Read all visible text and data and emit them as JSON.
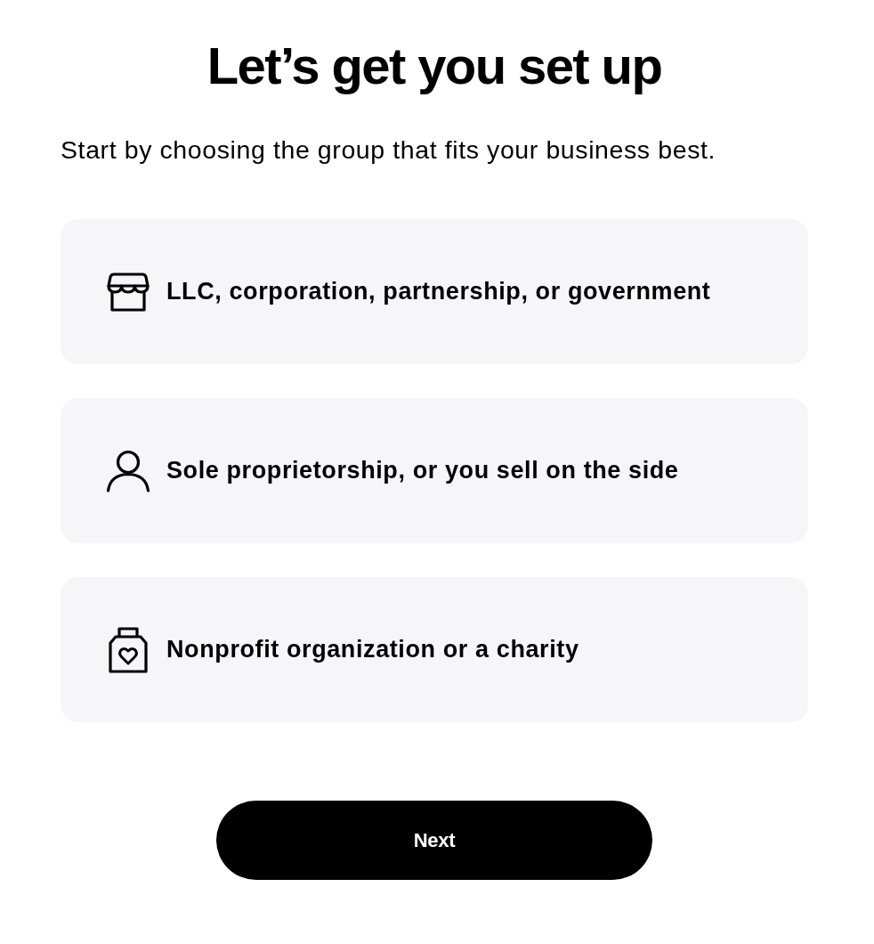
{
  "title": "Let’s get you set up",
  "subtitle": "Start by choosing the group that fits your business best.",
  "options": [
    {
      "label": "LLC, corporation, partnership, or government",
      "selected": false
    },
    {
      "label": "Sole proprietorship, or you sell on the side",
      "selected": false
    },
    {
      "label": "Nonprofit organization or a charity",
      "selected": false
    }
  ],
  "next_button": {
    "label": "Next"
  }
}
